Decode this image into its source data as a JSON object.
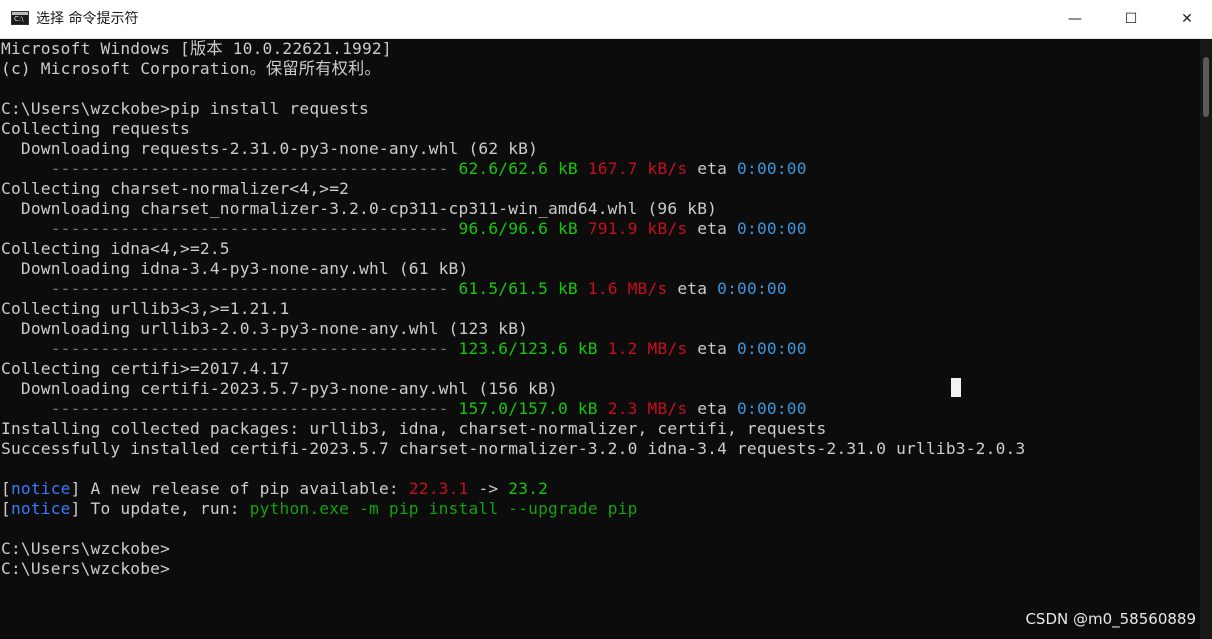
{
  "window": {
    "title": "选择 命令提示符",
    "icon": "cmd-icon",
    "minimize_icon": "—",
    "maximize_icon": "☐",
    "close_icon": "✕"
  },
  "console": {
    "lines": [
      {
        "t": "Microsoft Windows [版本 10.0.22621.1992]"
      },
      {
        "t": "(c) Microsoft Corporation。保留所有权利。"
      },
      {
        "t": ""
      },
      {
        "t": "C:\\Users\\wzckobe>pip install requests"
      },
      {
        "t": "Collecting requests"
      },
      {
        "t": "  Downloading requests-2.31.0-py3-none-any.whl (62 kB)"
      },
      {
        "bar": "     ---------------------------------------- ",
        "size": "62.6/62.6 kB",
        "speed": "167.7 kB/s",
        "eta": "eta",
        "time": "0:00:00"
      },
      {
        "t": "Collecting charset-normalizer<4,>=2"
      },
      {
        "t": "  Downloading charset_normalizer-3.2.0-cp311-cp311-win_amd64.whl (96 kB)"
      },
      {
        "bar": "     ---------------------------------------- ",
        "size": "96.6/96.6 kB",
        "speed": "791.9 kB/s",
        "eta": "eta",
        "time": "0:00:00"
      },
      {
        "t": "Collecting idna<4,>=2.5"
      },
      {
        "t": "  Downloading idna-3.4-py3-none-any.whl (61 kB)"
      },
      {
        "bar": "     ---------------------------------------- ",
        "size": "61.5/61.5 kB",
        "speed": "1.6 MB/s",
        "eta": "eta",
        "time": "0:00:00"
      },
      {
        "t": "Collecting urllib3<3,>=1.21.1"
      },
      {
        "t": "  Downloading urllib3-2.0.3-py3-none-any.whl (123 kB)"
      },
      {
        "bar": "     ---------------------------------------- ",
        "size": "123.6/123.6 kB",
        "speed": "1.2 MB/s",
        "eta": "eta",
        "time": "0:00:00"
      },
      {
        "t": "Collecting certifi>=2017.4.17"
      },
      {
        "t": "  Downloading certifi-2023.5.7-py3-none-any.whl (156 kB)"
      },
      {
        "bar": "     ---------------------------------------- ",
        "size": "157.0/157.0 kB",
        "speed": "2.3 MB/s",
        "eta": "eta",
        "time": "0:00:00"
      },
      {
        "t": "Installing collected packages: urllib3, idna, charset-normalizer, certifi, requests"
      },
      {
        "t": "Successfully installed certifi-2023.5.7 charset-normalizer-3.2.0 idna-3.4 requests-2.31.0 urllib3-2.0.3"
      },
      {
        "t": ""
      },
      {
        "notice": "notice",
        "msg": " A new release of pip available: ",
        "old": "22.3.1",
        "arrow": " -> ",
        "new": "23.2"
      },
      {
        "notice": "notice",
        "msg": " To update, run: ",
        "cmd": "python.exe -m pip install --upgrade pip"
      },
      {
        "t": ""
      },
      {
        "t": "C:\\Users\\wzckobe>"
      },
      {
        "t": "C:\\Users\\wzckobe>"
      }
    ]
  },
  "watermark": "CSDN @m0_58560889"
}
